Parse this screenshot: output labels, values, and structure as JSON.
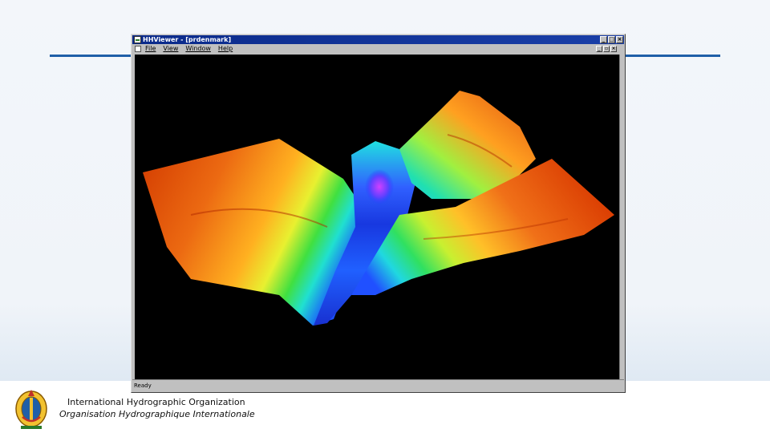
{
  "slide": {
    "accent_color": "#1f5fa8",
    "organization_en": "International Hydrographic Organization",
    "organization_fr": "Organisation Hydrographique Internationale",
    "logo_icon": "iho-emblem-icon"
  },
  "window": {
    "title": "HHViewer - [prdenmark]",
    "title_bar_color": "#0a2a8a",
    "controls": [
      "minimize-icon",
      "maximize-icon",
      "close-icon"
    ],
    "menu": [
      "File",
      "View",
      "Window",
      "Help"
    ],
    "status_text": "Ready"
  },
  "viewport": {
    "content": "3d-bathymetry-surface",
    "background": "#000000",
    "colormap": [
      "#cc2a00",
      "#ff8a1a",
      "#ffe030",
      "#40e040",
      "#20e0e0",
      "#2040ff",
      "#c030ff"
    ]
  }
}
